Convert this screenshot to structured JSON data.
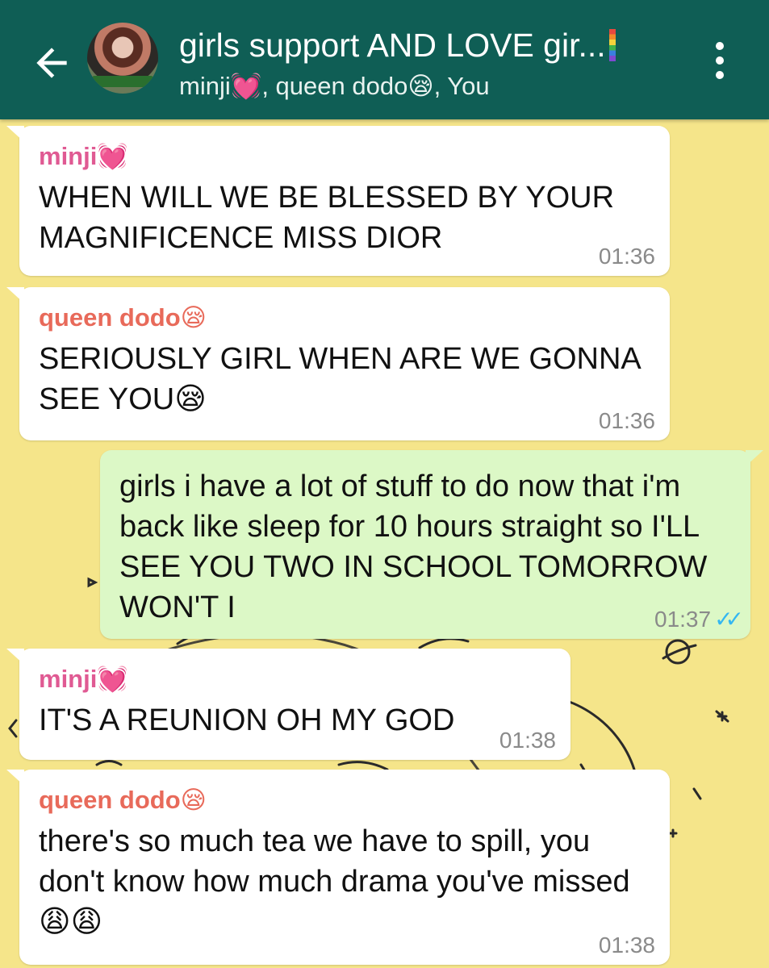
{
  "header": {
    "title": "girls support AND LOVE gir...",
    "members": "minji💓, queen dodo😪, You",
    "colors": {
      "bar": "#0f5e55",
      "background": "#f5e58a",
      "outgoing": "#dcf8c6"
    }
  },
  "messages": [
    {
      "sender": "minji💓",
      "text": "WHEN WILL WE BE BLESSED BY YOUR MAGNIFICENCE MISS DIOR",
      "time": "01:36"
    },
    {
      "sender": "queen dodo😪",
      "text": "SERIOUSLY GIRL WHEN ARE WE GONNA SEE YOU😪",
      "time": "01:36"
    },
    {
      "sender": "You",
      "text": "girls i have a lot of stuff to do now that i'm back like sleep for 10 hours straight so I'LL SEE YOU TWO IN SCHOOL TOMORROW WON'T I",
      "time": "01:37",
      "ticks": "✓✓"
    },
    {
      "sender": "minji💓",
      "text": "IT'S A REUNION OH MY GOD",
      "time": "01:38"
    },
    {
      "sender": "queen dodo😪",
      "text": "there's so much tea we have to spill, you don't know how much drama you've missed😩😩",
      "time": "01:38"
    }
  ]
}
